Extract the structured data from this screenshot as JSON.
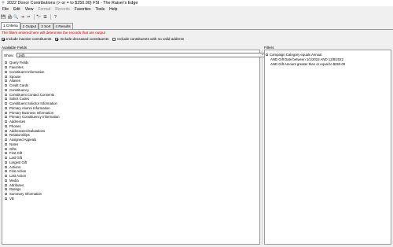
{
  "window": {
    "title": "2022 Donor Contributions (> or = to $250.00) FSI - The Raiser's Edge"
  },
  "menu": [
    {
      "label": "File",
      "disabled": false
    },
    {
      "label": "Edit",
      "disabled": false
    },
    {
      "label": "View",
      "disabled": false
    },
    {
      "label": "Format",
      "disabled": true
    },
    {
      "label": "Records",
      "disabled": true
    },
    {
      "label": "Favorites",
      "disabled": false
    },
    {
      "label": "Tools",
      "disabled": false
    },
    {
      "label": "Help",
      "disabled": false
    }
  ],
  "toolbar": {
    "icons": [
      "save-icon",
      "print-icon",
      "print-preview-icon",
      "export-icon",
      "cut-icon",
      "binoculars-icon",
      "find-icon",
      "help-icon"
    ],
    "glyphs": [
      "💾",
      "🖨",
      "🔍",
      "⇥",
      "✂",
      "🔭",
      "☰",
      "?"
    ]
  },
  "tabs": [
    {
      "label": "1 Criteria",
      "active": true
    },
    {
      "label": "2 Output",
      "active": false
    },
    {
      "label": "3 Sort",
      "active": false
    },
    {
      "label": "4 Results",
      "active": false
    }
  ],
  "warning": "The filters entered here will determine the records that are output",
  "options": [
    {
      "label": "Include inactive constituents",
      "checked": true
    },
    {
      "label": "Include deceased constituents",
      "checked": true
    },
    {
      "label": "Include constituents with no valid address",
      "checked": false
    }
  ],
  "available_fields": {
    "label": "Available Fields",
    "show_label": "Show:",
    "show_value": "(All)",
    "items": [
      "Query Fields",
      "Favorites",
      "Constituent Information",
      "Spouse",
      "Aliases",
      "Credit Cards",
      "Constituency",
      "Constituent Contact Consents",
      "Solicit Codes",
      "Constituent Solicitor Information",
      "Primary Alumni Information",
      "Primary Business Information",
      "Primary Constituency Information",
      "Addresses",
      "Phones",
      "Addressees/Salutations",
      "Relationships",
      "Assigned Appeals",
      "Notes",
      "Gifts",
      "First Gift",
      "Last Gift",
      "Largest Gift",
      "Actions",
      "First Action",
      "Last Action",
      "Media",
      "Attributes",
      "Ratings",
      "Summary Information",
      "VB"
    ]
  },
  "filters": {
    "label": "Filters",
    "items": [
      {
        "text": "Campaign Category equals Annual",
        "indent": false
      },
      {
        "text": "AND Gift Date between 1/1/2022 AND 12/8/2022",
        "indent": true
      },
      {
        "text": "AND Gift Amount greater than or equal to $250.00",
        "indent": true
      }
    ]
  }
}
